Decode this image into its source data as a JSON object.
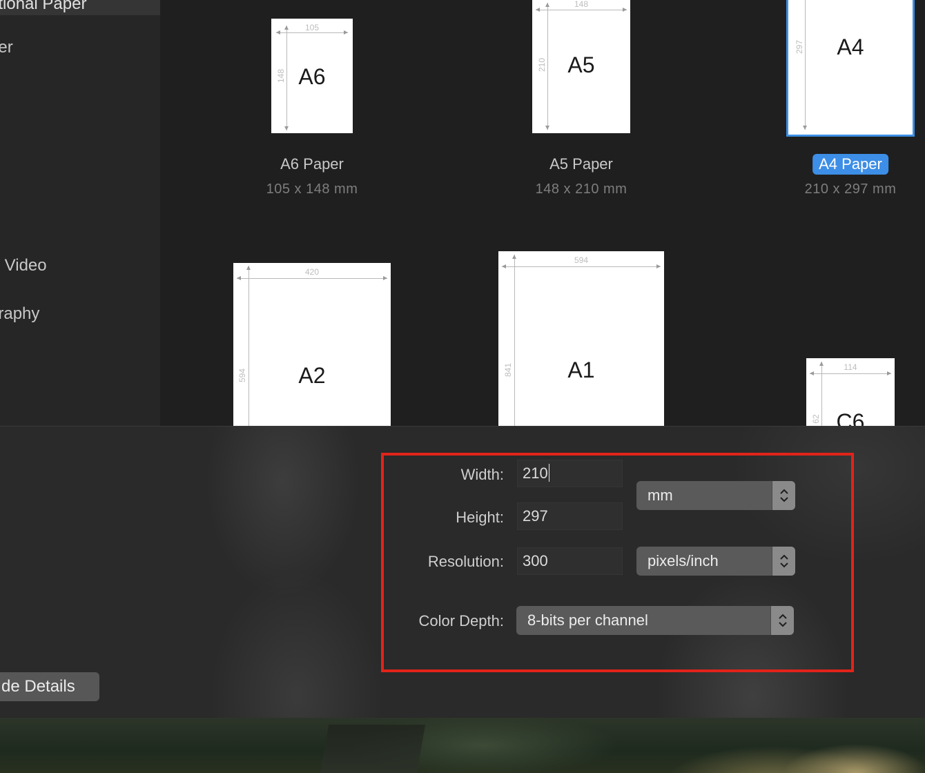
{
  "sidebar": {
    "items": [
      {
        "label": "ational Paper",
        "selected": true
      },
      {
        "label": "per",
        "selected": false
      },
      {
        "label": " Video",
        "selected": false
      },
      {
        "label": "graphy",
        "selected": false
      }
    ]
  },
  "presets": [
    {
      "short": "A6",
      "name": "A6 Paper",
      "size": "105 x 148 mm",
      "w_dim": "105",
      "h_dim": "148",
      "selected": false
    },
    {
      "short": "A5",
      "name": "A5 Paper",
      "size": "148 x 210 mm",
      "w_dim": "148",
      "h_dim": "210",
      "selected": false
    },
    {
      "short": "A4",
      "name": "A4 Paper",
      "size": "210 x 297 mm",
      "w_dim": "",
      "h_dim": "297",
      "selected": true
    },
    {
      "short": "A2",
      "name": "",
      "size": "",
      "w_dim": "420",
      "h_dim": "594",
      "selected": false
    },
    {
      "short": "A1",
      "name": "",
      "size": "",
      "w_dim": "594",
      "h_dim": "841",
      "selected": false
    },
    {
      "short": "C6",
      "name": "",
      "size": "",
      "w_dim": "114",
      "h_dim": "62",
      "selected": false
    }
  ],
  "details": {
    "width_label": "Width:",
    "width_value": "210",
    "height_label": "Height:",
    "height_value": "297",
    "units_value": "mm",
    "resolution_label": "Resolution:",
    "resolution_value": "300",
    "resolution_units_value": "pixels/inch",
    "color_depth_label": "Color Depth:",
    "color_depth_value": "8-bits per channel",
    "toggle_details_label": "de Details"
  },
  "colors": {
    "accent": "#3d8ee6",
    "highlight": "#e2231a"
  }
}
